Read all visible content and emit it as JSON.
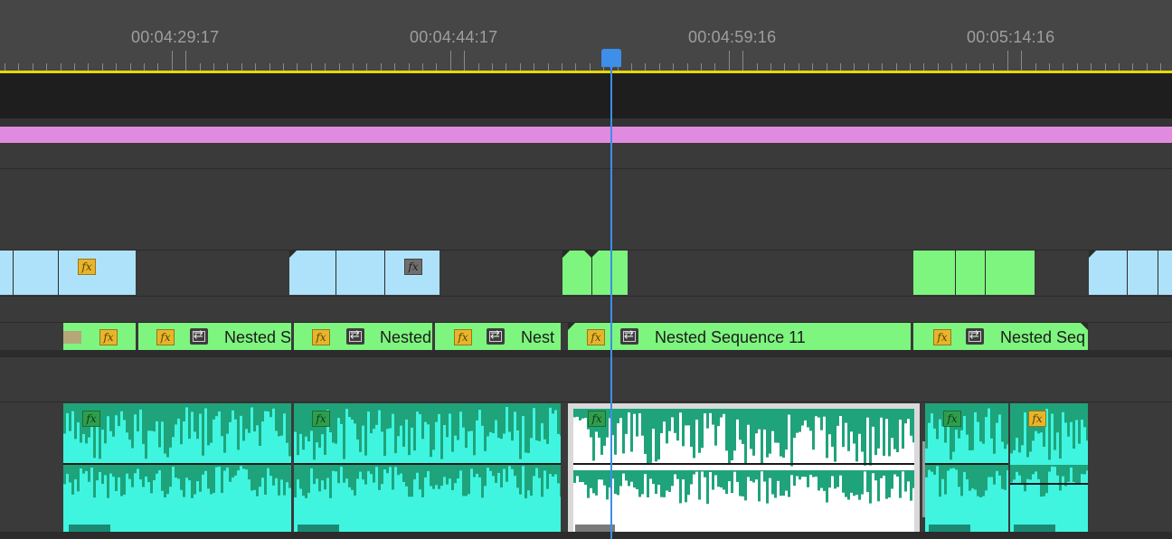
{
  "ruler": {
    "timecodes": [
      "00:04:29:17",
      "00:04:44:17",
      "00:04:59:16",
      "00:05:14:16"
    ]
  },
  "playhead": {
    "timecode_position": "between 00:04:44:17 and 00:04:59:16"
  },
  "video_track_fx": [
    "fx",
    "fx"
  ],
  "nested_clips": [
    {
      "fx": "fx",
      "label": ""
    },
    {
      "fx": "fx",
      "label": "Nested S"
    },
    {
      "fx": "fx",
      "label": "Nested"
    },
    {
      "fx": "fx",
      "label": "Nest"
    },
    {
      "fx": "fx",
      "label": "Nested Sequence 11"
    },
    {
      "fx": "fx",
      "label": "Nested Seq"
    }
  ],
  "audio_clips": [
    {
      "fx": "fx"
    },
    {
      "fx": "fx"
    },
    {
      "fx": "fx"
    },
    {
      "fx": "fx"
    },
    {
      "fx": "fx"
    }
  ],
  "colors": {
    "work_area": "#e8d800",
    "playhead": "#3d8fe8",
    "video_clip": "#aee2fb",
    "nested_clip": "#7ef57e",
    "audio_clip": "#1fa37a",
    "audio_wave": "#3ff5e0",
    "adjustment_track": "#e08ae0",
    "fx_badge": "#e7b52b"
  }
}
